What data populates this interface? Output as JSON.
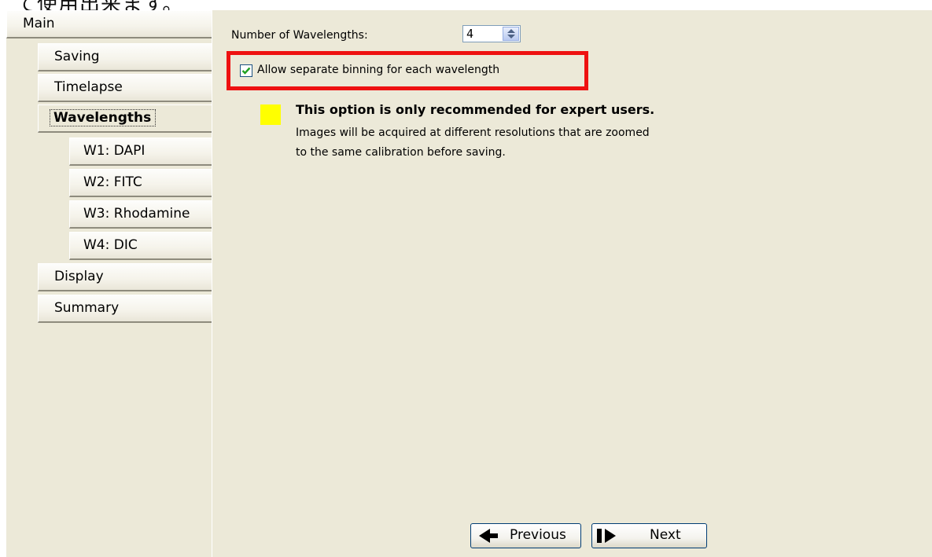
{
  "top_fragment": "て使用出来ます。",
  "sidebar": {
    "items": [
      {
        "label": "Main"
      },
      {
        "label": "Saving"
      },
      {
        "label": "Timelapse"
      },
      {
        "label": "Wavelengths"
      },
      {
        "label": "W1: DAPI"
      },
      {
        "label": "W2: FITC"
      },
      {
        "label": "W3: Rhodamine"
      },
      {
        "label": "W4: DIC"
      },
      {
        "label": "Display"
      },
      {
        "label": "Summary"
      }
    ],
    "selected": "Wavelengths"
  },
  "main": {
    "num_wavelengths_label": "Number of Wavelengths:",
    "num_wavelengths_value": "4",
    "separate_binning_label": "Allow separate binning for each wavelength",
    "separate_binning_checked": true,
    "warning_title": "This option is only recommended for expert users.",
    "warning_line1": "Images will be acquired at different resolutions that are zoomed",
    "warning_line2": "to the same calibration before saving.",
    "warning_color": "#ffff00",
    "highlight_color": "#ee1111"
  },
  "footer": {
    "previous_label": "Previous",
    "next_label": "Next"
  },
  "colors": {
    "window_bg": "#ece9d8"
  }
}
